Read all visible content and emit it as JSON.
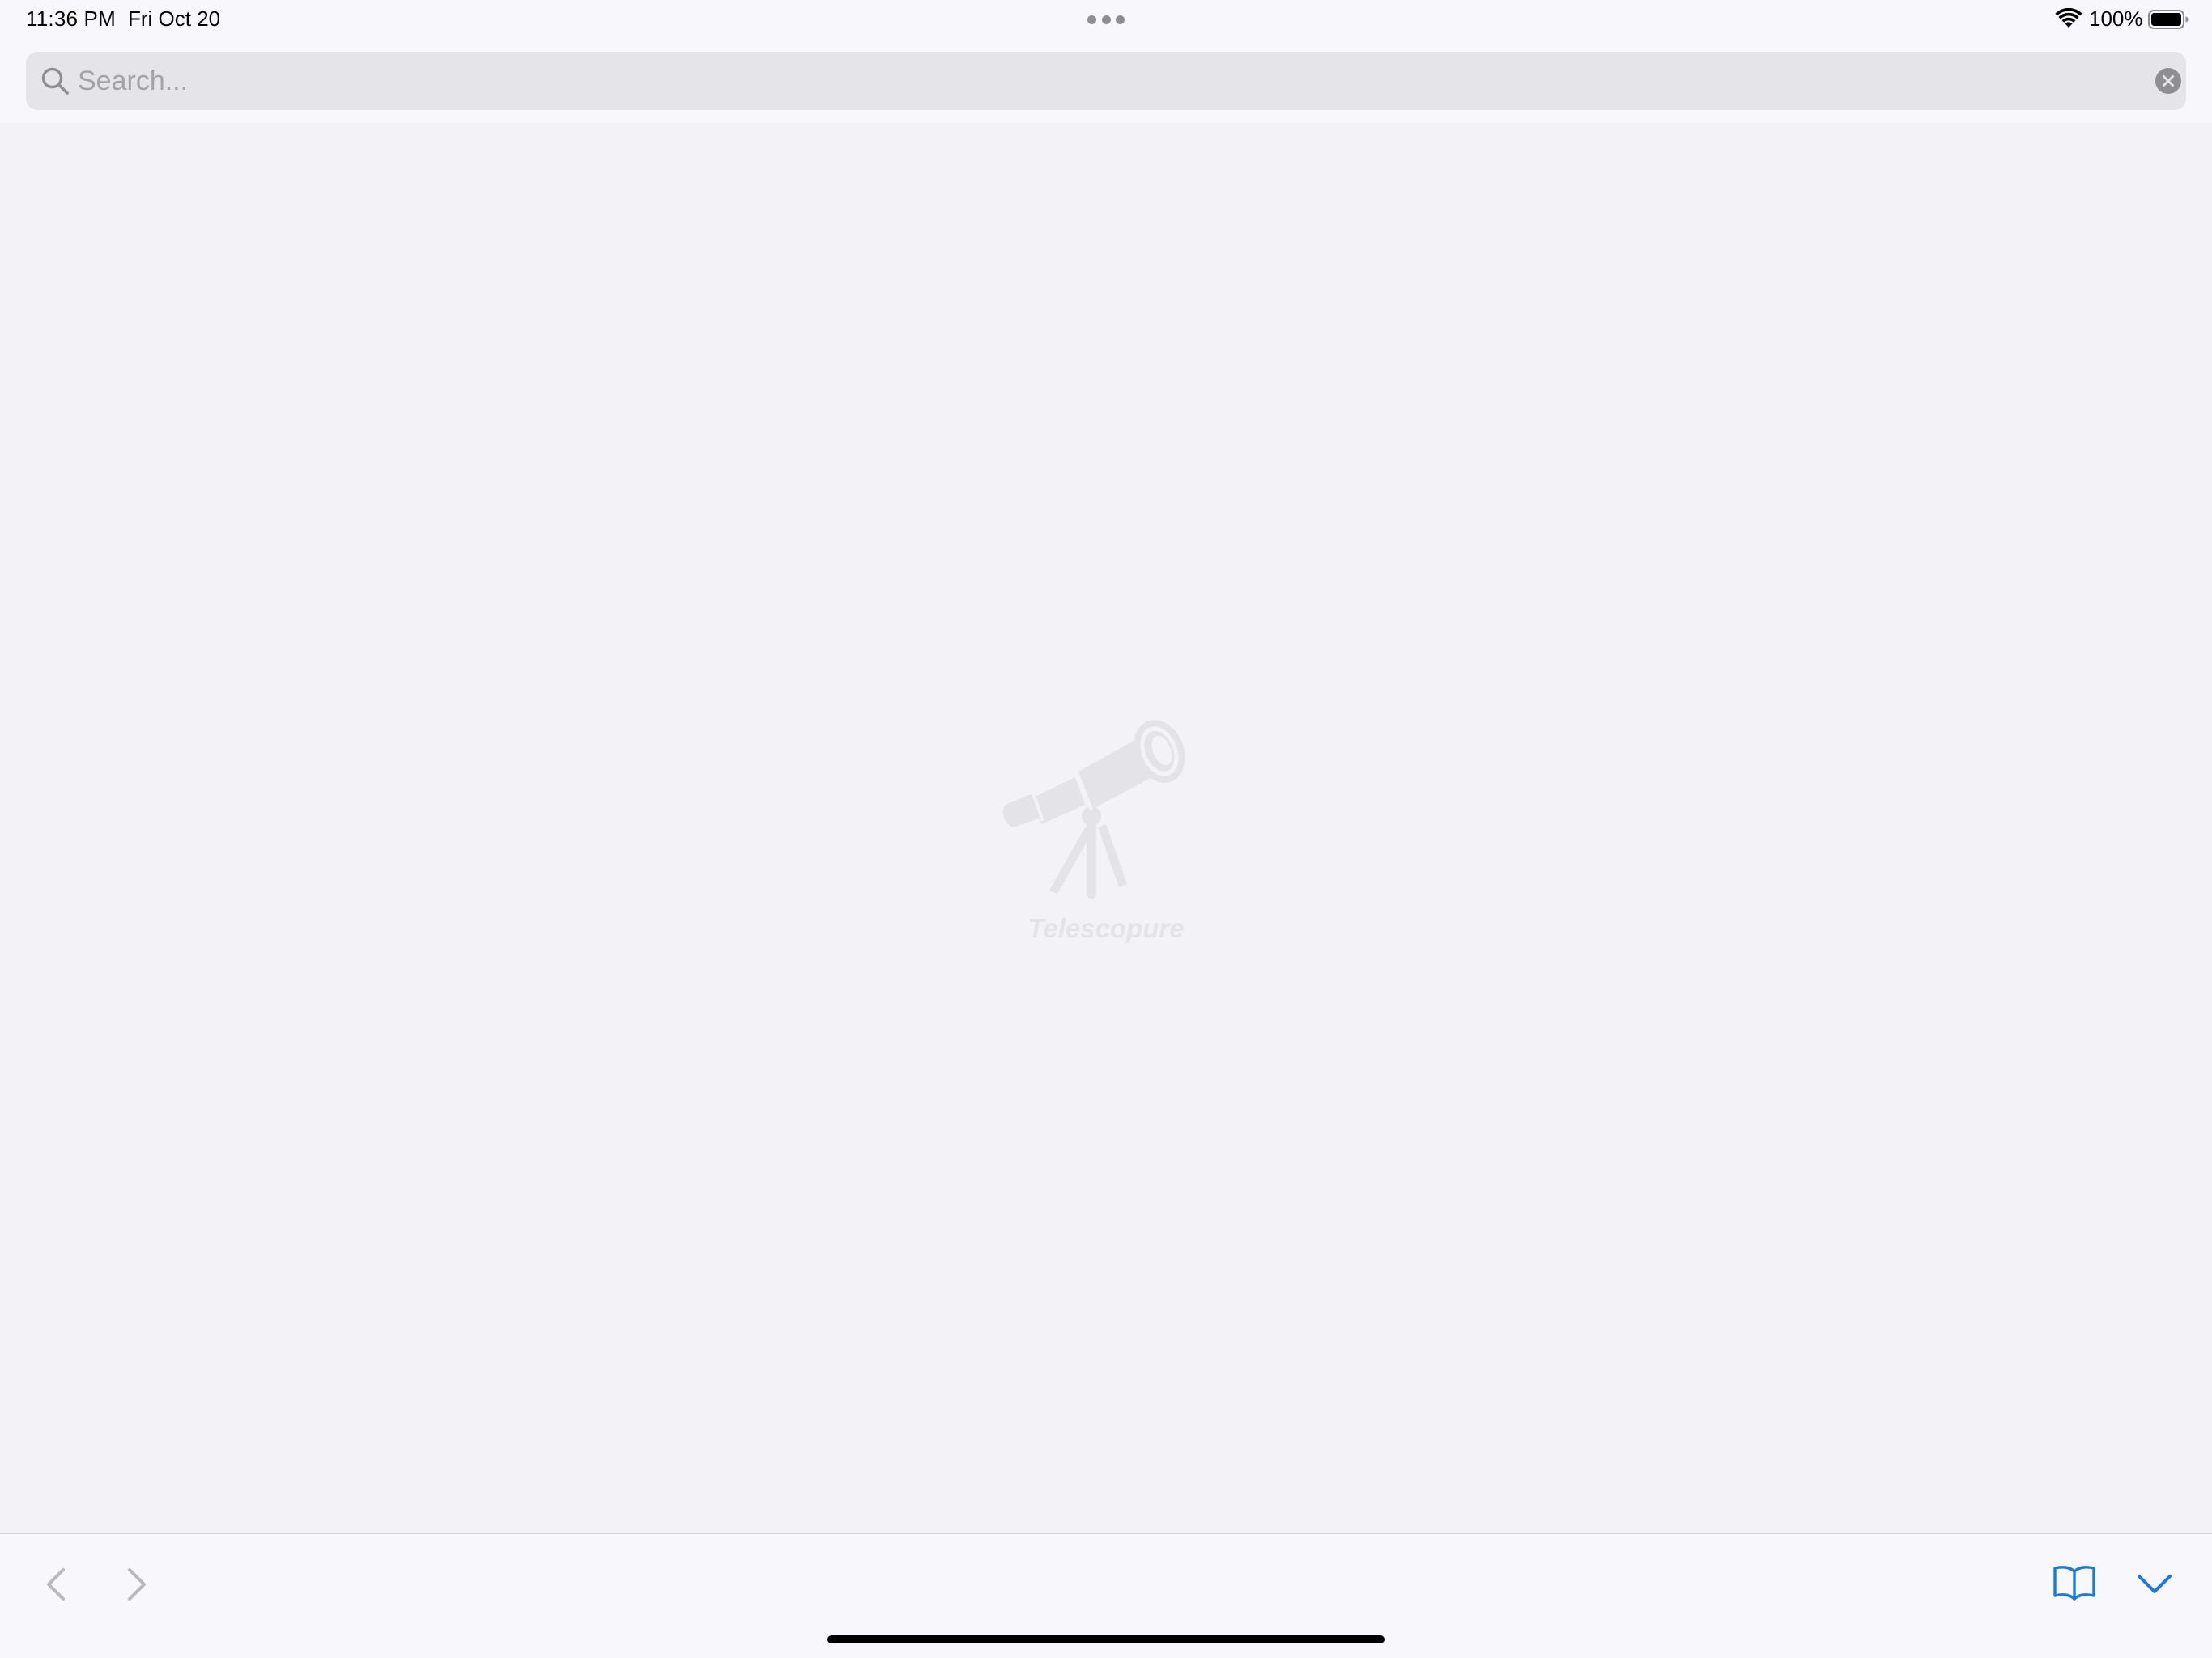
{
  "status_bar": {
    "time": "11:36 PM",
    "date": "Fri Oct 20",
    "battery": "100%",
    "icons": [
      "wifi-icon",
      "battery-icon"
    ]
  },
  "search": {
    "placeholder": "Search...",
    "value": "",
    "icon": "search-icon",
    "clear_icon": "clear-icon"
  },
  "empty_state": {
    "icon": "telescope-icon",
    "title": "Telescopure"
  },
  "toolbar": {
    "back_icon": "chevron-left-icon",
    "forward_icon": "chevron-right-icon",
    "bookmarks_icon": "book-icon",
    "collapse_icon": "chevron-down-icon"
  },
  "colors": {
    "background": "#f2f2f7",
    "bar_background": "#f8f8fc",
    "accent": "#1a7ae0",
    "disabled": "#b8b8bd",
    "placeholder_art": "#e3e3e8"
  }
}
